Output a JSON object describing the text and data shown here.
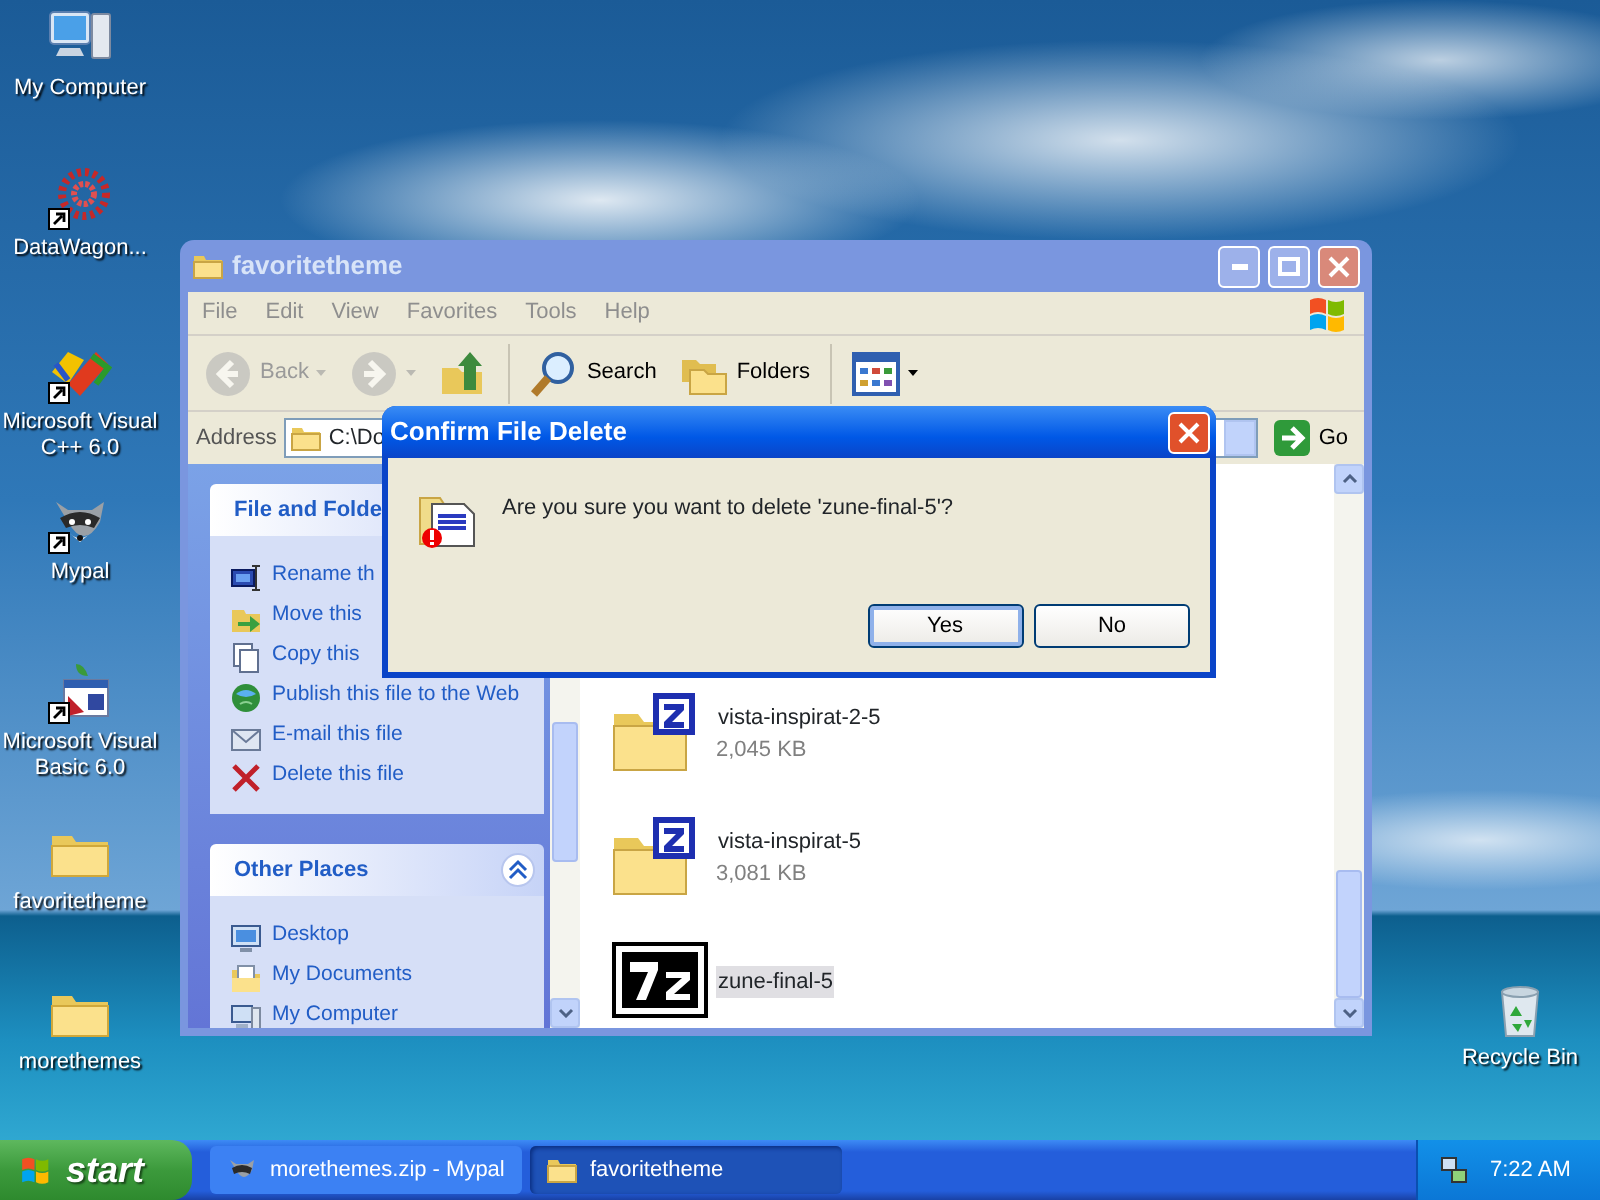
{
  "desktop_icons": [
    {
      "label": "My Computer",
      "kind": "computer",
      "shortcut": false
    },
    {
      "label": "DataWagon...",
      "kind": "flower",
      "shortcut": true
    },
    {
      "label": "Microsoft Visual C++ 6.0",
      "kind": "vcpp",
      "shortcut": true
    },
    {
      "label": "Mypal",
      "kind": "raccoon",
      "shortcut": true
    },
    {
      "label": "Microsoft Visual Basic 6.0",
      "kind": "vb",
      "shortcut": true
    },
    {
      "label": "favoritetheme",
      "kind": "folder",
      "shortcut": false
    },
    {
      "label": "morethemes",
      "kind": "folder",
      "shortcut": false
    }
  ],
  "recycle_bin": {
    "label": "Recycle Bin"
  },
  "explorer": {
    "title": "favoritetheme",
    "menu": [
      "File",
      "Edit",
      "View",
      "Favorites",
      "Tools",
      "Help"
    ],
    "toolbar": [
      {
        "kind": "back",
        "label": "Back",
        "disabled": true
      },
      {
        "kind": "forward",
        "disabled": true
      },
      {
        "kind": "up",
        "disabled": false
      },
      {
        "kind": "search",
        "label": "Search",
        "disabled": false
      },
      {
        "kind": "folders",
        "label": "Folders",
        "disabled": false
      },
      {
        "kind": "views",
        "disabled": false
      }
    ],
    "address": {
      "label": "Address",
      "value": "C:\\Do",
      "go": "Go"
    },
    "task_panels": [
      {
        "title": "File and Folde",
        "items": [
          {
            "kind": "rename",
            "label": "Rename th"
          },
          {
            "kind": "move",
            "label": "Move this"
          },
          {
            "kind": "copy",
            "label": "Copy this"
          },
          {
            "kind": "publish",
            "label": "Publish this file to the Web"
          },
          {
            "kind": "email",
            "label": "E-mail this file"
          },
          {
            "kind": "delete",
            "label": "Delete this file"
          }
        ]
      },
      {
        "title": "Other Places",
        "collapse_button": true,
        "items": [
          {
            "kind": "desktop",
            "label": "Desktop"
          },
          {
            "kind": "documents",
            "label": "My Documents"
          },
          {
            "kind": "computer",
            "label": "My Computer"
          }
        ]
      }
    ],
    "files": [
      {
        "name": "vista-inspirat-2-5",
        "size": "2,045 KB",
        "kind": "zip",
        "selected": false
      },
      {
        "name": "vista-inspirat-5",
        "size": "3,081 KB",
        "kind": "zip",
        "selected": false
      },
      {
        "name": "zune-final-5",
        "kind": "sevenzip",
        "selected": true
      }
    ]
  },
  "dialog": {
    "title": "Confirm File Delete",
    "message": "Are you sure you want to delete 'zune-final-5'?",
    "buttons": [
      {
        "label": "Yes",
        "default": true
      },
      {
        "label": "No",
        "default": false
      }
    ]
  },
  "taskbar": {
    "start": "start",
    "tasks": [
      {
        "label": "morethemes.zip - Mypal",
        "kind": "raccoon",
        "selected": false
      },
      {
        "label": "favoritetheme",
        "kind": "folder",
        "selected": true
      }
    ],
    "clock": "7:22 AM"
  }
}
